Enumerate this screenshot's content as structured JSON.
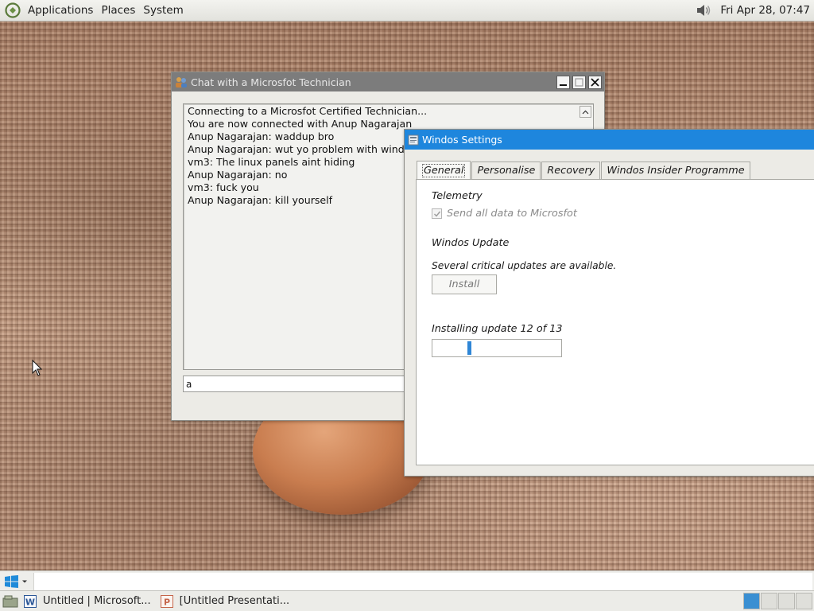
{
  "top_panel": {
    "menus": [
      "Applications",
      "Places",
      "System"
    ],
    "clock": "Fri Apr 28, 07:47",
    "icons": [
      "distro-logo-icon",
      "speaker-icon"
    ]
  },
  "chat_window": {
    "title": "Chat with a Microsfot Technician",
    "lines": [
      "Connecting to a Microsfot Certified Technician...",
      "You are now connected with Anup Nagarajan",
      "Anup Nagarajan: waddup bro",
      "Anup Nagarajan: wut yo problem with windo $",
      "vm3: The linux panels aint hiding",
      "Anup Nagarajan: no",
      "vm3: fuck you",
      "Anup Nagarajan: kill yourself"
    ],
    "input_value": "a"
  },
  "settings_window": {
    "title": "Windos Settings",
    "tabs": [
      "General",
      "Personalise",
      "Recovery",
      "Windos Insider Programme"
    ],
    "active_tab": "General",
    "telemetry": {
      "heading": "Telemetry",
      "checkbox_label": "Send all data to Microsfot",
      "checked": true,
      "disabled": true
    },
    "update": {
      "heading": "Windos Update",
      "status": "Several critical updates are available.",
      "install_label": "Install",
      "progress_label": "Installing update 12 of 13",
      "progress_fraction": 0.28
    }
  },
  "bottom_panel": {
    "launcher_input": "",
    "tasks": [
      {
        "label": "Untitled | Microsoft...",
        "icon": "word-document-icon"
      },
      {
        "label": "[Untitled Presentati...",
        "icon": "presentation-icon"
      }
    ],
    "workspaces": 4,
    "active_workspace": 0
  },
  "colors": {
    "settings_title": "#1e86dd",
    "chat_title": "#7c7c7c",
    "progress": "#2f86d6"
  }
}
